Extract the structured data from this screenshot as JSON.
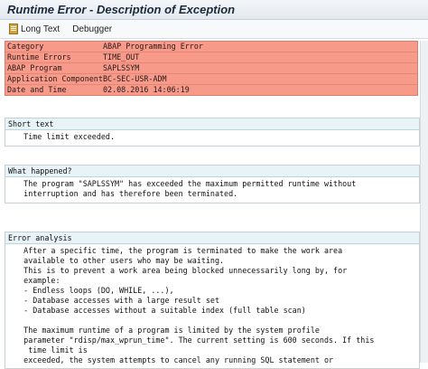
{
  "window": {
    "title": "Runtime Error - Description of Exception"
  },
  "toolbar": {
    "long_text_label": "Long Text",
    "debugger_label": "Debugger"
  },
  "header": {
    "rows": [
      {
        "label": "Category",
        "value": "ABAP Programming Error"
      },
      {
        "label": "Runtime Errors",
        "value": "TIME_OUT"
      },
      {
        "label": "ABAP Program",
        "value": "SAPLSSYM"
      },
      {
        "label": "Application Component",
        "value": "BC-SEC-USR-ADM"
      },
      {
        "label": "Date and Time",
        "value": "02.08.2016 14:06:19"
      }
    ]
  },
  "short_text": {
    "title": "Short text",
    "lines": [
      "    Time limit exceeded."
    ]
  },
  "what_happened": {
    "title": "What happened?",
    "lines": [
      "    The program \"SAPLSSYM\" has exceeded the maximum permitted runtime without",
      "    interruption and has therefore been terminated."
    ]
  },
  "error_analysis": {
    "title": "Error analysis",
    "lines": [
      "    After a specific time, the program is terminated to make the work area",
      "    available to other users who may be waiting.",
      "    This is to prevent a work area being blocked unnecessarily long by, for",
      "    example:",
      "    - Endless loops (DO, WHILE, ...),",
      "    - Database accesses with a large result set",
      "    - Database accesses without a suitable index (full table scan)",
      "",
      "    The maximum runtime of a program is limited by the system profile",
      "    parameter \"rdisp/max_wprun_time\". The current setting is 600 seconds. If this",
      "     time limit is",
      "    exceeded, the system attempts to cancel any running SQL statement or"
    ]
  }
}
